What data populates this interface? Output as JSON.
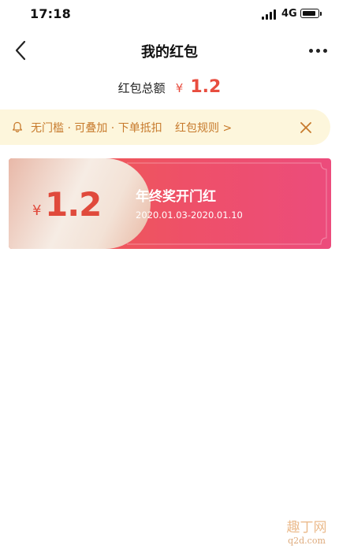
{
  "status_bar": {
    "time": "17:18",
    "network": "4G",
    "icons": [
      "signal-icon",
      "battery-icon"
    ]
  },
  "nav": {
    "title": "我的红包",
    "back_icon": "chevron-left-icon",
    "more_icon": "more-dots-icon"
  },
  "summary": {
    "label": "红包总额",
    "currency": "¥",
    "amount": "1.2"
  },
  "notice": {
    "icon": "bell-icon",
    "text": "无门槛 · 可叠加 · 下单抵扣",
    "rules_link": "红包规则 >",
    "close_icon": "close-icon"
  },
  "coupons": [
    {
      "currency": "¥",
      "amount": "1.2",
      "title": "年终奖开门红",
      "validity": "2020.01.03-2020.01.10"
    }
  ],
  "watermark": {
    "text": "趣丁网",
    "domain": "q2d.com"
  },
  "colors": {
    "accent_red": "#e84d3f",
    "notice_bg": "#fdf6dc",
    "notice_text": "#c77a2c",
    "coupon_gradient_start": "#f0604a",
    "coupon_gradient_end": "#ec4c7c"
  }
}
